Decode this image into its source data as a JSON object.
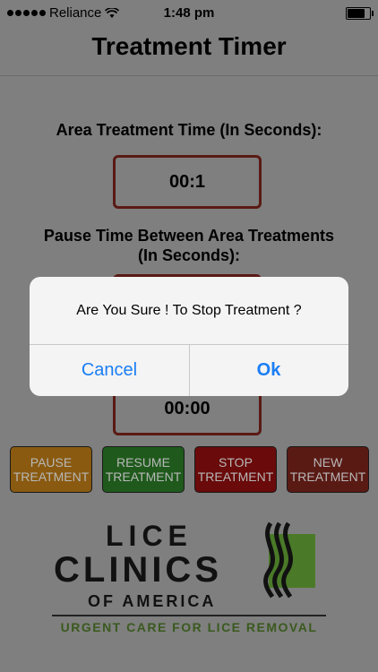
{
  "status_bar": {
    "carrier": "Reliance",
    "time": "1:48 pm",
    "battery_level": 0.8
  },
  "header": {
    "title": "Treatment Timer"
  },
  "area_treatment": {
    "label": "Area Treatment Time (In Seconds):",
    "value": "00:1"
  },
  "pause_time": {
    "label_line1": "Pause Time Between Area Treatments",
    "label_line2": "(In Seconds):"
  },
  "total_timer": {
    "value": "00:00"
  },
  "buttons": {
    "pause": {
      "line1": "PAUSE",
      "line2": "TREATMENT",
      "color": "#8a5a10"
    },
    "resume": {
      "line1": "RESUME",
      "line2": "TREATMENT",
      "color": "#1f5a1c"
    },
    "stop": {
      "line1": "STOP",
      "line2": "TREATMENT",
      "color": "#6a0a0a"
    },
    "new": {
      "line1": "NEW",
      "line2": "TREATMENT",
      "color": "#5a1a14"
    }
  },
  "logo": {
    "line1": "LICE",
    "line2": "CLINICS",
    "line3": "OF AMERICA",
    "tagline": "URGENT CARE FOR LICE REMOVAL",
    "accent_color": "#4a7a28"
  },
  "alert": {
    "message": "Are You Sure ! To Stop Treatment ?",
    "cancel_label": "Cancel",
    "ok_label": "Ok",
    "button_color": "#1a7ef5"
  }
}
